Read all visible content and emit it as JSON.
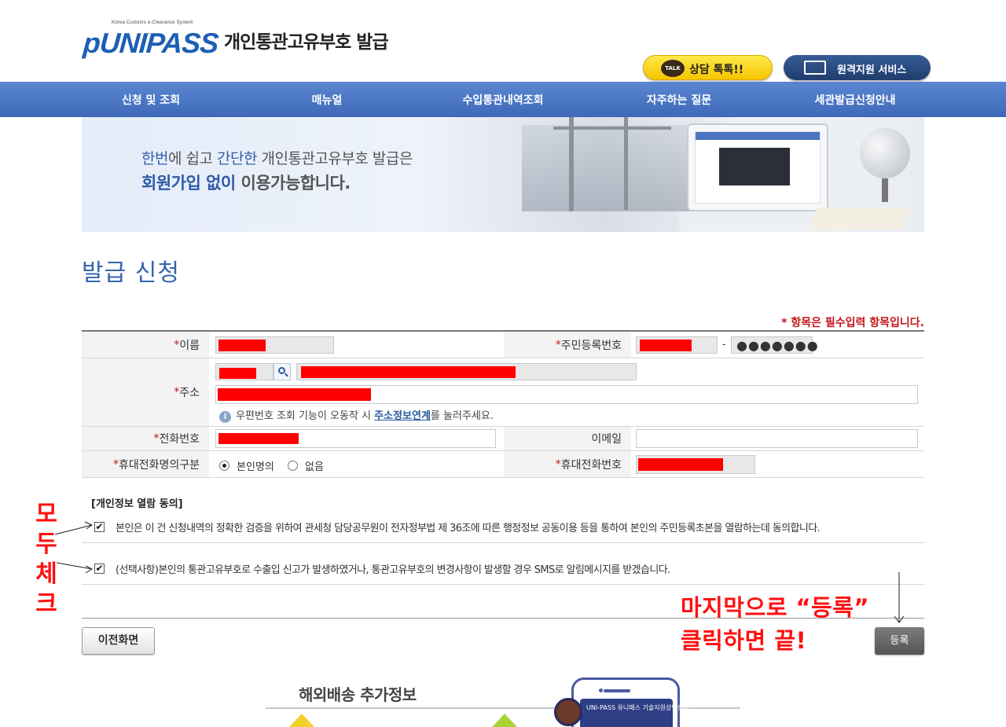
{
  "header": {
    "logo_tagline": "Korea Customs e-Clearance System",
    "logo_text_a": "pUNI",
    "logo_text_dash": "-",
    "logo_text_b": "PASS",
    "site_title": "개인통관고유부호 발급",
    "talk_icon_text": "TALK",
    "talk_button": "상담 톡톡!!",
    "remote_button": "원격지원 서비스"
  },
  "nav": {
    "items": [
      "신청 및 조회",
      "매뉴얼",
      "수입통관내역조회",
      "자주하는 질문",
      "세관발급신청안내"
    ]
  },
  "banner": {
    "line1_a": "한번",
    "line1_b": "에 쉽고 ",
    "line1_c": "간단한",
    "line1_d": " 개인통관고유부호 발급은",
    "line2_a": "회원가입 없이",
    "line2_b": " 이용가능합니다."
  },
  "page_title": "발급 신청",
  "required_note": "* 항목은 필수입력 항목입니다.",
  "form": {
    "star": "*",
    "name_label": "이름",
    "rrn_label": "주민등록번호",
    "rrn_separator": "-",
    "rrn_masked": "●●●●●●●",
    "address_label": "주소",
    "address_help_a": "우편번호 조회 기능이 오동작 시 ",
    "address_help_link": "주소정보연계",
    "address_help_b": "를 눌러주세요.",
    "phone_label": "전화번호",
    "email_label": "이메일",
    "mobile_owner_label": "휴대전화명의구분",
    "mobile_owner_options": [
      "본인명의",
      "없음"
    ],
    "mobile_owner_selected": "본인명의",
    "mobile_label": "휴대전화번호"
  },
  "consent": {
    "title": "[개인정보 열람 동의]",
    "items": [
      {
        "text": "본인은 이 건 신청내역의 정확한 검증을 위하여 관세청 담당공무원이 전자정부법 제 36조에 따른 행정정보 공동이용 등을 통하여 본인의 주민등록초본을 열람하는데 동의합니다.",
        "checked": true
      },
      {
        "text": "(선택사항)본인의 통관고유부호로 수출입 신고가 발생하였거나, 통관고유부호의 변경사항이 발생할 경우 SMS로 알림메시지를 받겠습니다.",
        "checked": true
      }
    ],
    "check_mark": "✔"
  },
  "buttons": {
    "prev": "이전화면",
    "register": "등록"
  },
  "annotations": {
    "vertical": [
      "모",
      "두",
      "체",
      "크"
    ],
    "final_line1": "마지막으로 “등록”",
    "final_line2": "클릭하면 끝!",
    "color": "#ff1010"
  },
  "promo": {
    "title": "해외배송 추가정보",
    "phone_screen": "UNI-PASS 유니패스 기술지원상담센터"
  },
  "colors": {
    "nav": "#4a76c4",
    "title_blue": "#3565b0",
    "required_red": "#c4161c",
    "redaction": "#ff0000"
  }
}
